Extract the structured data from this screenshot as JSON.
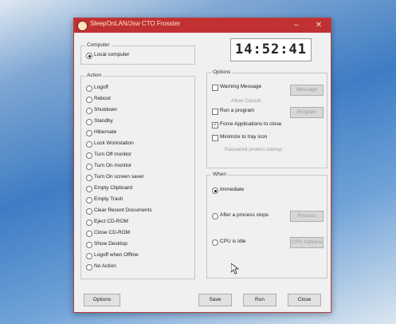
{
  "window": {
    "title": "SleepOnLAN/Jsw CTO Frosster",
    "minimize_glyph": "–",
    "close_glyph": "✕"
  },
  "computer": {
    "label": "Computer",
    "local_label": "Local computer",
    "local_selected": true
  },
  "clock": {
    "time": "14:52:41"
  },
  "action": {
    "label": "Action",
    "selected_index": 17,
    "items": [
      "Logoff",
      "Reboot",
      "Shutdown",
      "Standby",
      "Hibernate",
      "Lock Workstation",
      "Turn Off monitor",
      "Turn On monitor",
      "Turn On screen saver",
      "Empty Clipboard",
      "Empty Trash",
      "Clear Recent Documents",
      "Eject CD-ROM",
      "Close CD-ROM",
      "Show Desktop",
      "Logoff when Offline",
      "No Action"
    ]
  },
  "options": {
    "label": "Options",
    "warning_message": "Warning Message",
    "warning_message_checked": false,
    "message_button": "Message",
    "after_cancel": "Allow Cancel",
    "run_program": "Run a program",
    "run_program_checked": false,
    "program_button": "Program",
    "force_apps_close": "Force Applications to close",
    "force_apps_close_checked": true,
    "minimize_tray": "Minimize to tray icon",
    "minimize_tray_checked": false,
    "password_protect": "Password protect startup"
  },
  "when": {
    "label": "When",
    "immediate": "Immediate",
    "immediate_selected": true,
    "after_process": "After a process stops",
    "process_button": "Process",
    "cpu_idle": "CPU is Idle",
    "cpu_options_button": "CPU Options"
  },
  "buttons": {
    "options": "Options",
    "save": "Save",
    "run": "Run",
    "close": "Close"
  }
}
